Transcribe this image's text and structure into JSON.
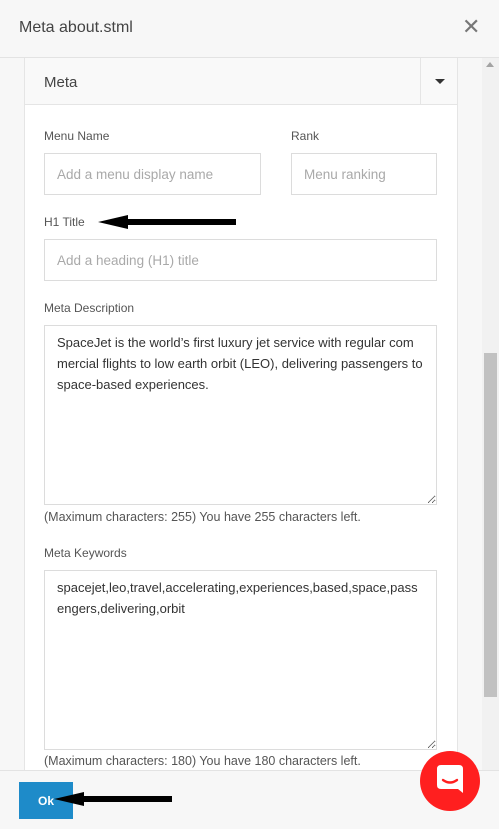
{
  "modal": {
    "title": "Meta about.stml"
  },
  "panel": {
    "title": "Meta"
  },
  "fields": {
    "menu_name": {
      "label": "Menu Name",
      "placeholder": "Add a menu display name"
    },
    "rank": {
      "label": "Rank",
      "placeholder": "Menu ranking"
    },
    "h1_title": {
      "label": "H1 Title",
      "placeholder": "Add a heading (H1) title"
    },
    "meta_description": {
      "label": "Meta Description",
      "value": "SpaceJet is the world’s first luxury jet service with regular commercial flights to low earth orbit (LEO), delivering passengers to space-based experiences.",
      "hint": "(Maximum characters: 255) You have 255 characters left."
    },
    "meta_keywords": {
      "label": "Meta Keywords",
      "value": "spacejet,leo,travel,accelerating,experiences,based,space,passengers,delivering,orbit",
      "hint": "(Maximum characters: 180) You have 180 characters left."
    }
  },
  "footer": {
    "ok_label": "Ok"
  },
  "icons": {
    "close": "close-icon",
    "caret": "caret-down-icon",
    "chat": "chat-icon"
  },
  "colors": {
    "primary_button": "#1e8bc9",
    "chat_bubble": "#ff1f1f"
  }
}
